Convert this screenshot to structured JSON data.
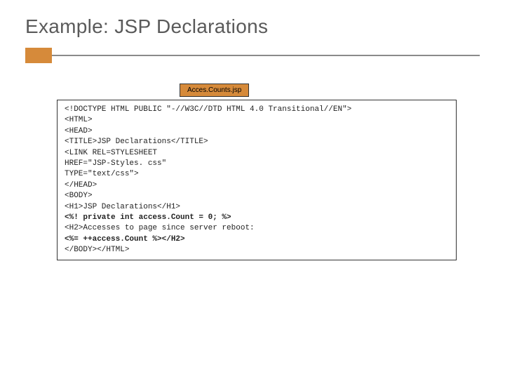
{
  "title": "Example: JSP Declarations",
  "file_tab": "Acces.Counts.jsp",
  "code": {
    "l1": "<!DOCTYPE HTML PUBLIC \"-//W3C//DTD HTML 4.0 Transitional//EN\">",
    "l2": "<HTML>",
    "l3": "<HEAD>",
    "l4": "<TITLE>JSP Declarations</TITLE>",
    "l5": "<LINK REL=STYLESHEET",
    "l6": "      HREF=\"JSP-Styles. css\"",
    "l7": "      TYPE=\"text/css\">",
    "l8": "</HEAD>",
    "l9": "<BODY>",
    "l10": "<H1>JSP Declarations</H1>",
    "l11": "<%! private int access.Count = 0; %>",
    "l12": "<H2>Accesses to page since server reboot:",
    "l13": "<%= ++access.Count %></H2>",
    "l14": "</BODY></HTML>"
  }
}
